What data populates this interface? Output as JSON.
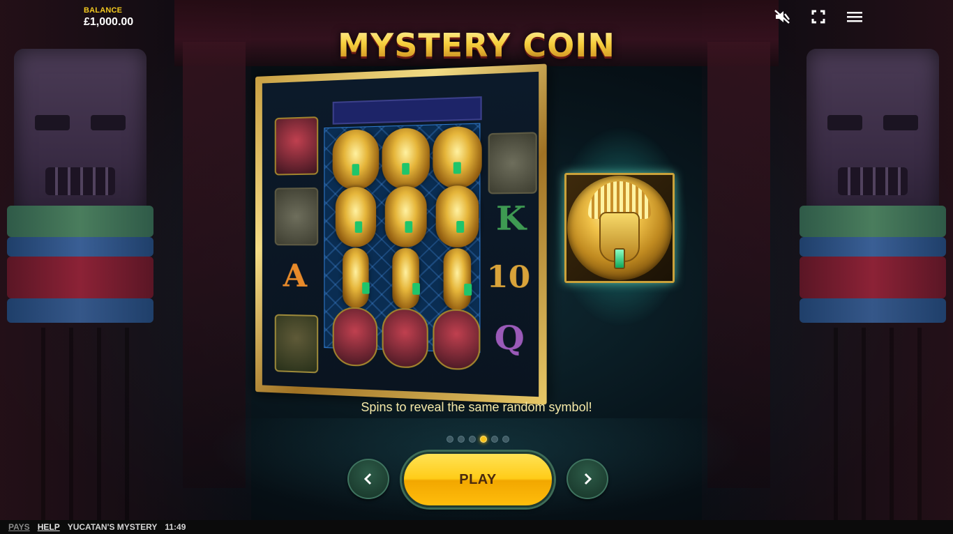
{
  "balance": {
    "label": "BALANCE",
    "value": "£1,000.00"
  },
  "top_controls": {
    "sound_icon": "sound-muted-icon",
    "fullscreen_icon": "fullscreen-icon",
    "menu_icon": "hamburger-menu-icon"
  },
  "feature": {
    "title": "MYSTERY COIN",
    "caption": "Spins to reveal the same random symbol!",
    "reel_letters": [
      "A",
      "K",
      "10",
      "Q"
    ]
  },
  "pagination": {
    "total": 6,
    "active_index": 3
  },
  "controls": {
    "play_label": "PLAY",
    "prev_icon": "chevron-left-icon",
    "next_icon": "chevron-right-icon"
  },
  "footer": {
    "pays": "PAYS",
    "help": "HELP",
    "game_name": "YUCATAN'S MYSTERY",
    "clock": "11:49"
  },
  "colors": {
    "accent_gold": "#f7c21a",
    "button_green": "#2d5b48",
    "caption_text": "#f5e9a8"
  }
}
